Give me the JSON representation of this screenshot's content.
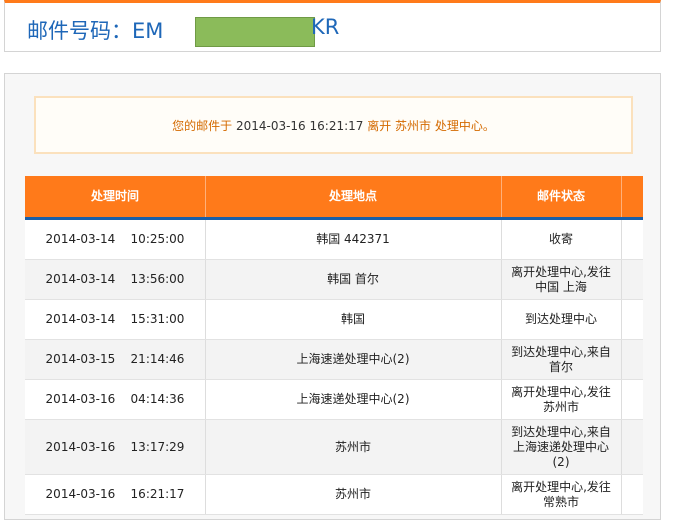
{
  "header": {
    "prefix": "邮件号码：EM",
    "suffix": "KR"
  },
  "notice": {
    "part1": "您的邮件于",
    "datetime": "2014-03-16 16:21:17",
    "part2": "离开 苏州市 处理中心。"
  },
  "table": {
    "headers": [
      "处理时间",
      "处理地点",
      "邮件状态"
    ],
    "rows": [
      {
        "time": "2014-03-14    10:25:00",
        "place": "韩国 442371",
        "status": "收寄"
      },
      {
        "time": "2014-03-14    13:56:00",
        "place": "韩国 首尔",
        "status": "离开处理中心,发往中国 上海"
      },
      {
        "time": "2014-03-14    15:31:00",
        "place": "韩国",
        "status": "到达处理中心"
      },
      {
        "time": "2014-03-15    21:14:46",
        "place": "上海速递处理中心(2)",
        "status": "到达处理中心,来自首尔"
      },
      {
        "time": "2014-03-16    04:14:36",
        "place": "上海速递处理中心(2)",
        "status": "离开处理中心,发往苏州市"
      },
      {
        "time": "2014-03-16    13:17:29",
        "place": "苏州市",
        "status": "到达处理中心,来自上海速递处理中心(2)"
      },
      {
        "time": "2014-03-16    16:21:17",
        "place": "苏州市",
        "status": "离开处理中心,发往常熟市"
      }
    ]
  }
}
